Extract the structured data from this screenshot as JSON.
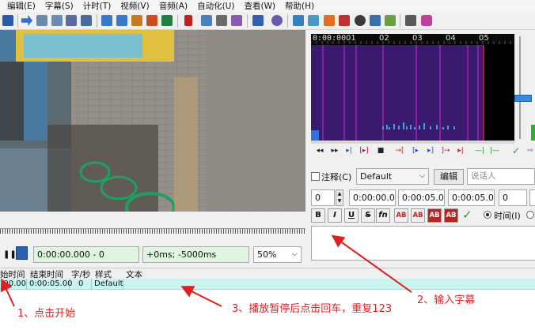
{
  "menu": {
    "items": [
      "编辑(E)",
      "字幕(S)",
      "计时(T)",
      "视频(V)",
      "音频(A)",
      "自动化(U)",
      "查看(W)",
      "帮助(H)"
    ]
  },
  "waveform": {
    "timeline_labels": [
      "0:00:00",
      "01",
      "02",
      "03",
      "04",
      "05"
    ]
  },
  "player": {
    "current_time": "0:00:00.000 - 0",
    "offset": "+0ms; -5000ms",
    "zoom": "50%"
  },
  "edit": {
    "comment_label": "注释(C)",
    "style": "Default",
    "edit_button": "编辑",
    "actor_placeholder": "说话人",
    "layer": "0",
    "start_time": "0:00:00.00",
    "end_time": "0:00:05.00",
    "duration": "0:00:05.00",
    "margin": "0",
    "time_radio_label": "时间(I)",
    "text": ""
  },
  "format_buttons": [
    "B",
    "I",
    "U",
    "S",
    "fn",
    "AB",
    "AB",
    "AB",
    "AB"
  ],
  "colors": {
    "accent_green": "#2a9d2a",
    "waveform_bg": "#000000",
    "waveform_region": "#3a1a6e",
    "waveform_marker": "#c020c0",
    "row_highlight": "#c8f5f0",
    "annotation_red": "#e02020"
  },
  "grid": {
    "columns": [
      "始时间",
      "结束时间",
      "字/秒",
      "样式",
      "文本"
    ],
    "rows": [
      {
        "start": ":00.00",
        "end": "0:00:05.00",
        "cps": "0",
        "style": "Default",
        "text": ""
      }
    ]
  },
  "annotations": {
    "a1": "1、点击开始",
    "a2": "2、输入字幕",
    "a3": "3、播放暂停后点击回车，重复123"
  }
}
